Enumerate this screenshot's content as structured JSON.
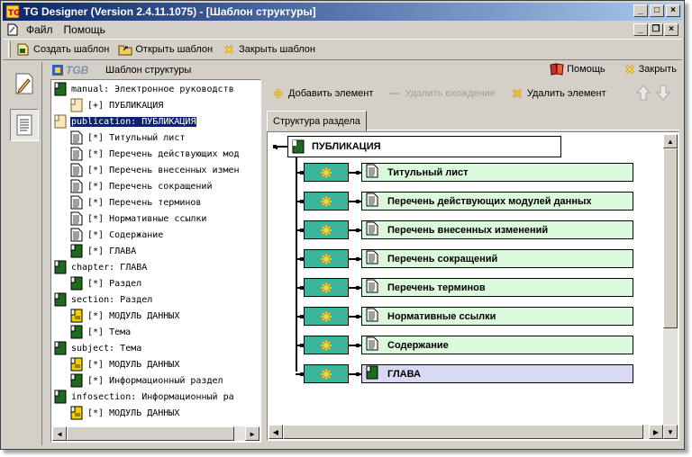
{
  "window": {
    "title": "TG Designer (Version 2.4.11.1075) - [Шаблон структуры]"
  },
  "menu": {
    "items": [
      "Файл",
      "Помощь"
    ]
  },
  "toolbar": {
    "create_template": "Создать шаблон",
    "open_template": "Открыть шаблон",
    "close_template": "Закрыть шаблон"
  },
  "panel": {
    "logo": "TGB",
    "title": "Шаблон структуры",
    "help": "Помощь",
    "close": "Закрыть"
  },
  "tree": {
    "rows": [
      {
        "text": "manual: Электронное руководств",
        "icon": "dark-green-doc-icon",
        "level": 0
      },
      {
        "text": "[+] ПУБЛИКАЦИЯ",
        "icon": "light-orange-doc-icon",
        "level": 1
      },
      {
        "text": "publication: ПУБЛИКАЦИЯ",
        "icon": "light-orange-doc-icon",
        "level": 0,
        "selected": true
      },
      {
        "text": "[*] Титульный лист",
        "icon": "page-icon",
        "level": 1
      },
      {
        "text": "[*] Перечень действующих мод",
        "icon": "page-icon",
        "level": 1
      },
      {
        "text": "[*] Перечень внесенных измен",
        "icon": "page-icon",
        "level": 1
      },
      {
        "text": "[*] Перечень сокращений",
        "icon": "page-icon",
        "level": 1
      },
      {
        "text": "[*] Перечень терминов",
        "icon": "page-icon",
        "level": 1
      },
      {
        "text": "[*] Нормативные ссылки",
        "icon": "page-icon",
        "level": 1
      },
      {
        "text": "[*] Содержание",
        "icon": "page-icon",
        "level": 1
      },
      {
        "text": "[*] ГЛАВА",
        "icon": "dark-green-doc-icon",
        "level": 1
      },
      {
        "text": "chapter: ГЛАВА",
        "icon": "dark-green-doc-icon",
        "level": 0
      },
      {
        "text": "[*] Раздел",
        "icon": "dark-green-doc-icon",
        "level": 1
      },
      {
        "text": "section: Раздел",
        "icon": "dark-green-doc-icon",
        "level": 0
      },
      {
        "text": "[*] МОДУЛЬ ДАННЫХ",
        "icon": "yellow-doc-icon",
        "level": 1
      },
      {
        "text": "[*] Тема",
        "icon": "dark-green-doc-icon",
        "level": 1
      },
      {
        "text": "subject: Тема",
        "icon": "dark-green-doc-icon",
        "level": 0
      },
      {
        "text": "[*] МОДУЛЬ ДАННЫХ",
        "icon": "yellow-doc-icon",
        "level": 1
      },
      {
        "text": "[*] Информационный раздел",
        "icon": "dark-green-doc-icon",
        "level": 1
      },
      {
        "text": "infosection: Информационный ра",
        "icon": "dark-green-doc-icon",
        "level": 0
      },
      {
        "text": "[*] МОДУЛЬ ДАННЫХ",
        "icon": "yellow-doc-icon",
        "level": 1
      }
    ]
  },
  "right_toolbar": {
    "add_element": "Добавить элемент",
    "remove_entry": "Удалить вхождение",
    "remove_element": "Удалить элемент"
  },
  "tabs": {
    "section_structure": "Структура раздела"
  },
  "diagram": {
    "root": "ПУБЛИКАЦИЯ",
    "children": [
      {
        "label": "Титульный лист",
        "icon": "page-icon"
      },
      {
        "label": "Перечень действующих модулей данных",
        "icon": "page-icon"
      },
      {
        "label": "Перечень внесенных изменений",
        "icon": "page-icon"
      },
      {
        "label": "Перечень сокращений",
        "icon": "page-icon"
      },
      {
        "label": "Перечень терминов",
        "icon": "page-icon"
      },
      {
        "label": "Нормативные ссылки",
        "icon": "page-icon"
      },
      {
        "label": "Содержание",
        "icon": "page-icon"
      },
      {
        "label": "ГЛАВА",
        "icon": "dark-green-doc-icon"
      }
    ]
  },
  "colors": {
    "title_start": "#0a246a",
    "title_end": "#a6caf0",
    "seq_box": "#3cb39a",
    "child_fill": "#dbfadb",
    "chapter_fill": "#d8daf4",
    "selection": "#0a246a"
  }
}
